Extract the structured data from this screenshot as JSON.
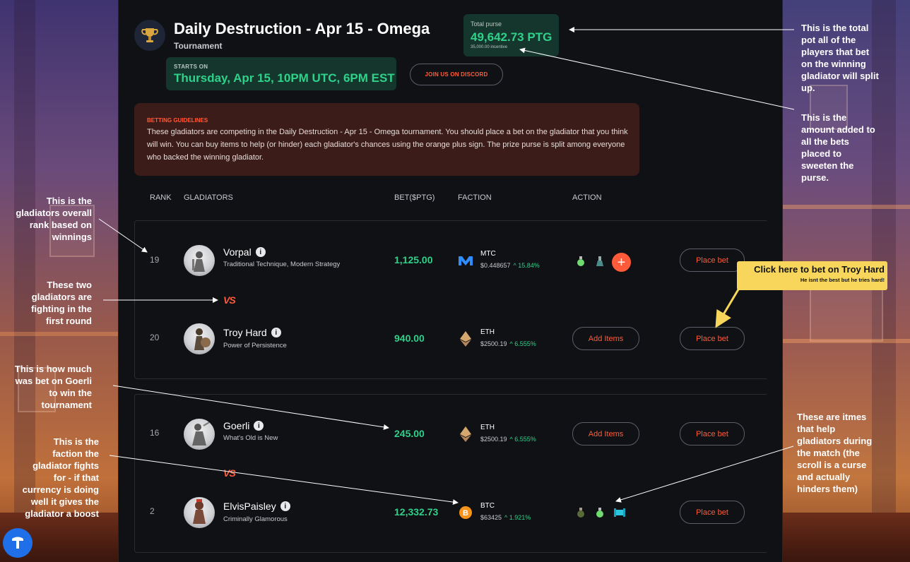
{
  "header": {
    "title": "Daily Destruction - Apr 15 - Omega",
    "subtitle": "Tournament",
    "starts_label": "STARTS ON",
    "starts_value": "Thursday, Apr 15, 10PM UTC, 6PM EST",
    "discord_label": "JOIN US ON DISCORD",
    "purse_label": "Total purse",
    "purse_value": "49,642.73 PTG",
    "purse_incentive": "35,000.00 incentive"
  },
  "guidelines": {
    "title": "BETTING GUIDELINES",
    "text": "These gladiators are competing in the Daily Destruction - Apr 15 - Omega tournament. You should place a bet on the gladiator that you think will win. You can buy items to help (or hinder) each gladiator's chances using the orange plus sign. The prize purse is split among everyone who backed the winning gladiator."
  },
  "table": {
    "headers": {
      "rank": "RANK",
      "gladiators": "GLADIATORS",
      "bet": "BET($PTG)",
      "faction": "FACTION",
      "action": "ACTION"
    },
    "vs_label": "VS",
    "add_items_label": "Add Items",
    "place_bet_label": "Place bet",
    "rows": [
      {
        "rank": "19",
        "name": "Vorpal",
        "desc": "Traditional Technique, Modern Strategy",
        "bet": "1,125.00",
        "faction": "MTC",
        "price": "$0.448657",
        "change": "^ 15.84%"
      },
      {
        "rank": "20",
        "name": "Troy Hard",
        "desc": "Power of Persistence",
        "bet": "940.00",
        "faction": "ETH",
        "price": "$2500.19",
        "change": "^ 6.555%"
      },
      {
        "rank": "16",
        "name": "Goerli",
        "desc": "What's Old is New",
        "bet": "245.00",
        "faction": "ETH",
        "price": "$2500.19",
        "change": "^ 6.555%"
      },
      {
        "rank": "2",
        "name": "ElvisPaisley",
        "desc": "Criminally Glamorous",
        "bet": "12,332.73",
        "faction": "BTC",
        "price": "$63425",
        "change": "^ 1.921%"
      }
    ]
  },
  "annotations": {
    "purse_note": "This is the total pot all of the players that bet on the winning gladiator will split up.",
    "incentive_note": "This is the amount added to all the bets placed to sweeten the purse.",
    "rank_note": "This is the gladiators overall rank based on winnings",
    "vs_note": "These two gladiators are fighting in the first round",
    "bet_note": "This is how much was bet on Goerli to win the tournament",
    "faction_note": "This is the faction the gladiator fights for - if that currency is doing well it gives the gladiator a boost",
    "items_note": "These are itmes that help gladiators during the match (the scroll is a curse and actually hinders them)",
    "callout_title": "Click here to bet on Troy Hard",
    "callout_sub": "He isnt the best but he tries hard!"
  },
  "colors": {
    "accent": "#ff5b3a",
    "positive": "#2fd18b",
    "panel": "#101114",
    "callout": "#f7d65b"
  }
}
